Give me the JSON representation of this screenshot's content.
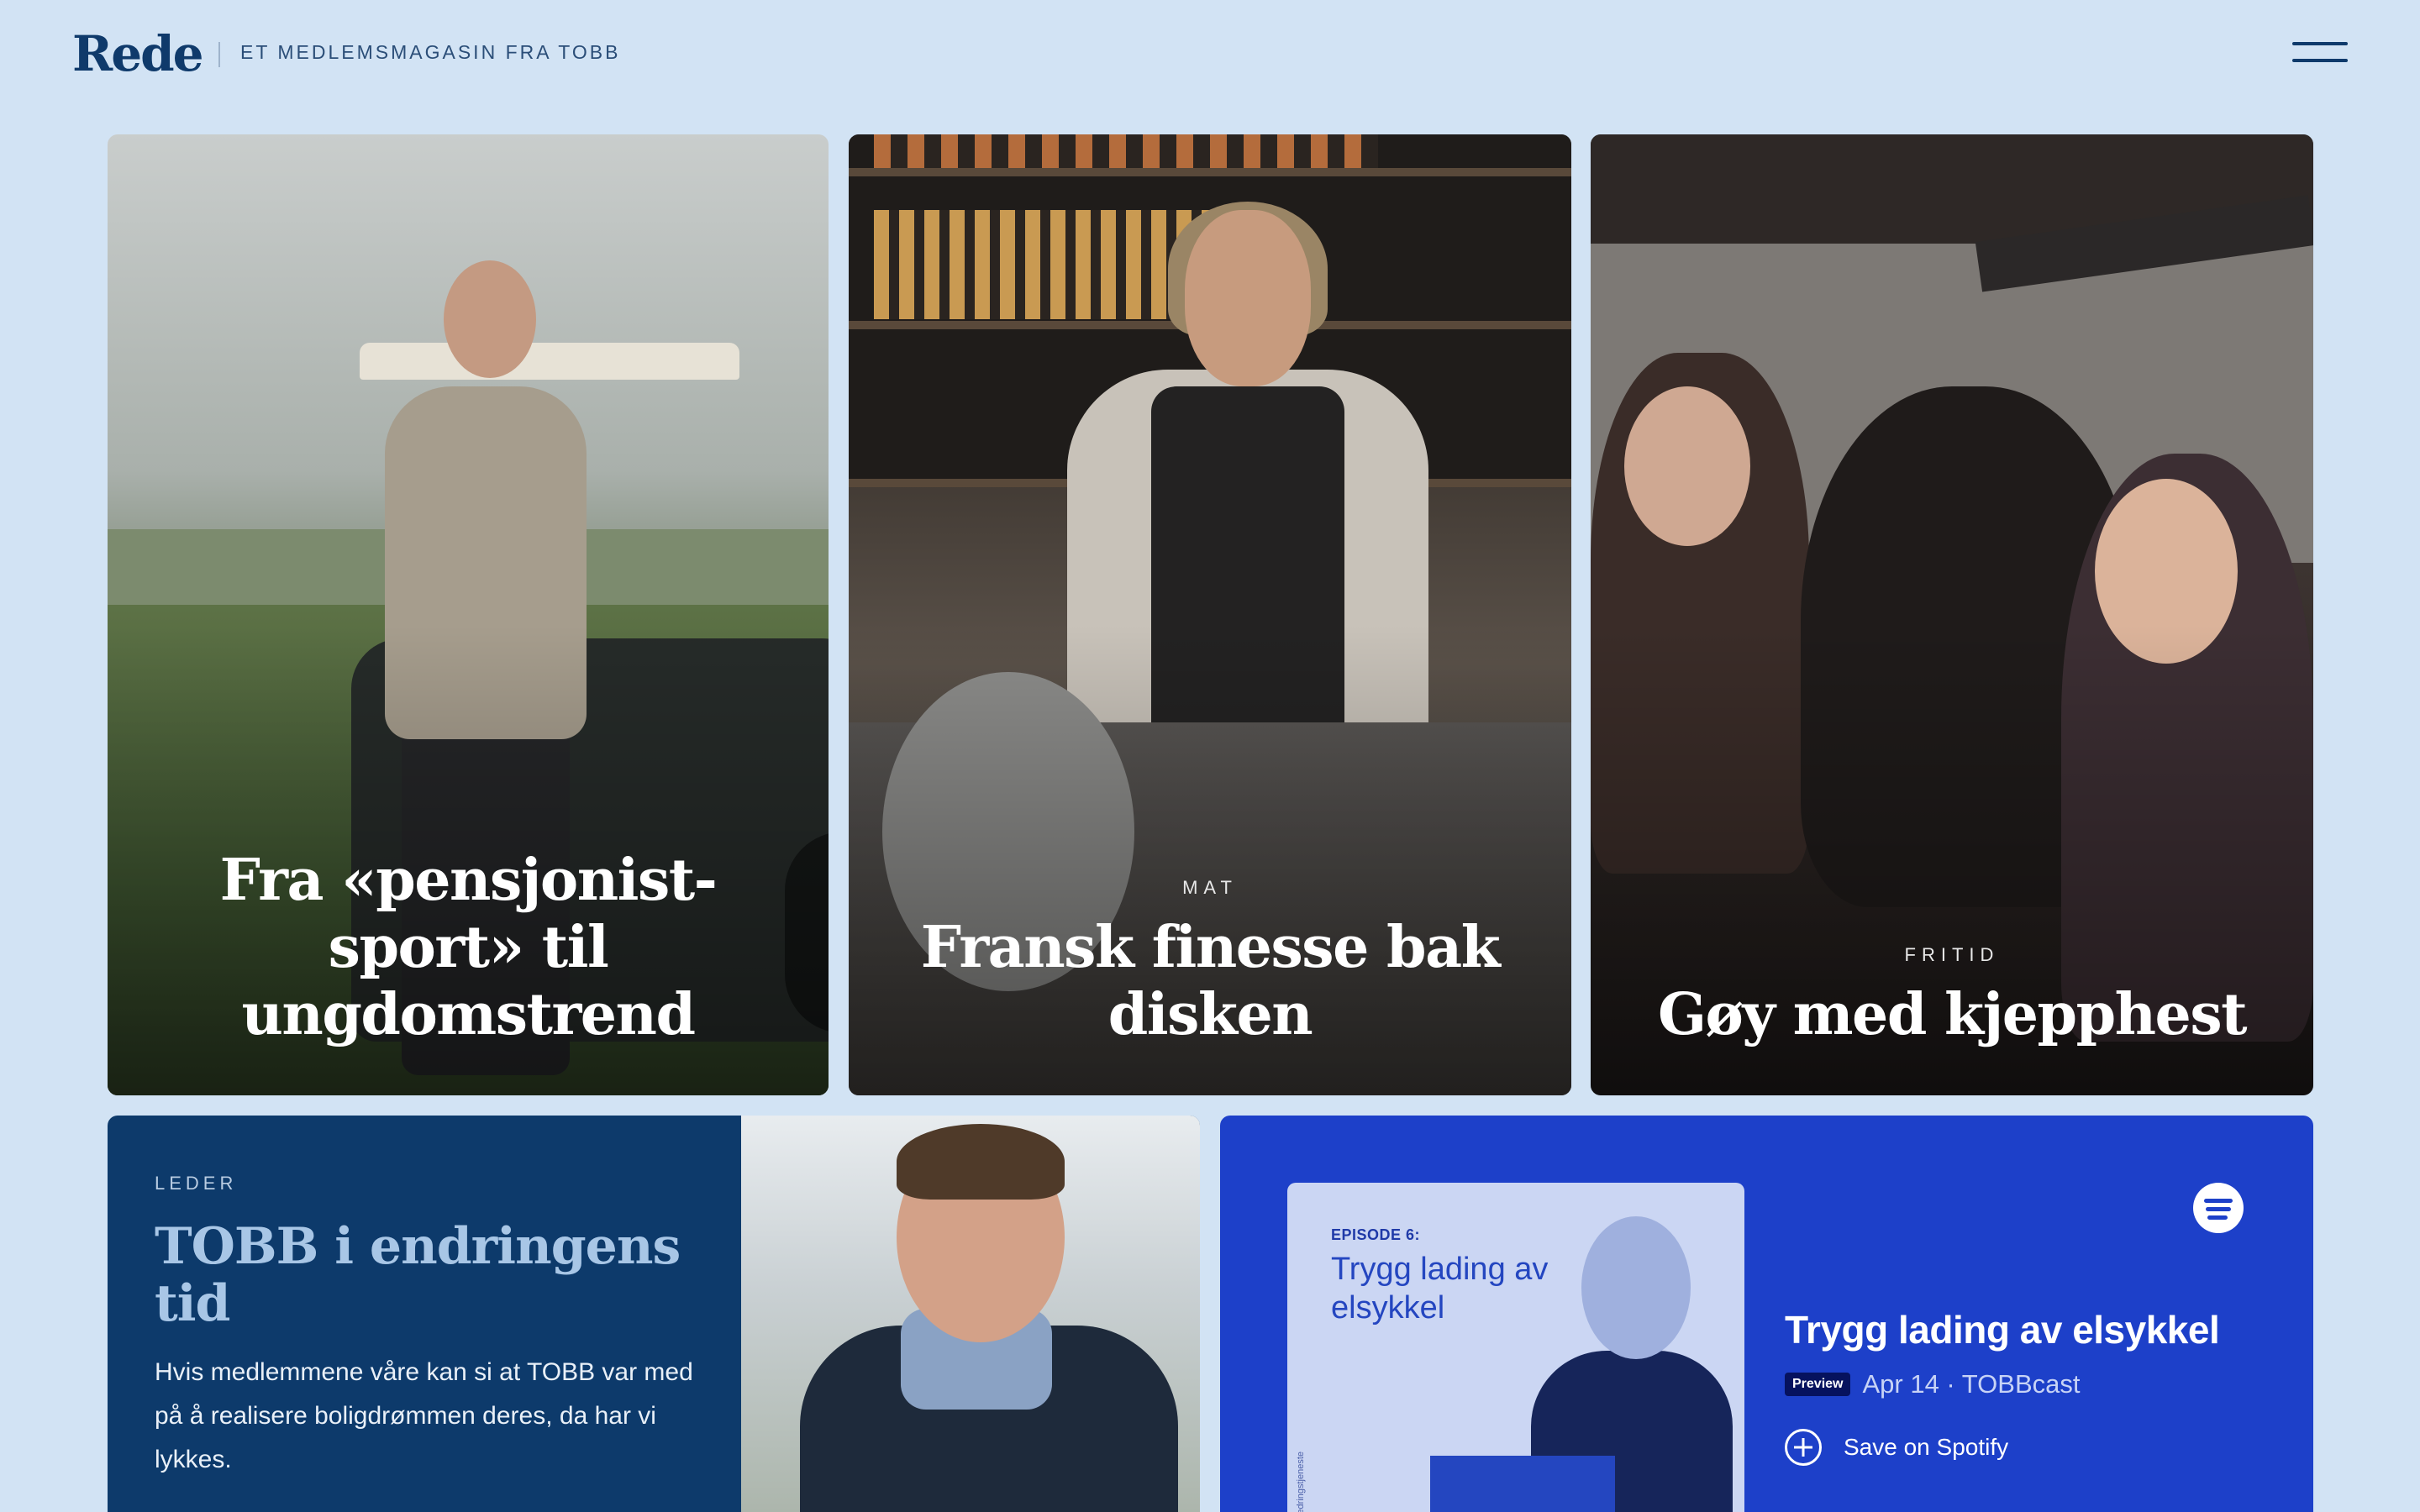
{
  "header": {
    "logo": "Rede",
    "tagline": "ET MEDLEMSMAGASIN FRA TOBB",
    "menu_icon": "hamburger-menu-icon"
  },
  "cards": [
    {
      "category": "",
      "title": "Fra «pensjonist-sport» til ungdomstrend"
    },
    {
      "category": "MAT",
      "title": "Fransk finesse bak disken"
    },
    {
      "category": "FRITID",
      "title": "Gøy med kjepphest"
    }
  ],
  "leader": {
    "category": "LEDER",
    "title": "TOBB i endringens tid",
    "body": "Hvis medlemmene våre kan si at TOBB var med på å realisere boligdrømmen deres, da har vi lykkes."
  },
  "podcast": {
    "cover_episode": "EPISODE 6:",
    "cover_title": "Trygg lading av elsykkel",
    "cover_side_text": "edringstjeneste",
    "title": "Trygg lading av elsykkel",
    "badge": "Preview",
    "meta": "Apr 14 · TOBBcast",
    "save_label": "Save on Spotify",
    "icon": "spotify-icon"
  },
  "colors": {
    "page_background": "#d2e3f4",
    "brand_navy": "#0f3a6b",
    "leader_background": "#0d3a6b",
    "podcast_background": "#1d40c9"
  }
}
